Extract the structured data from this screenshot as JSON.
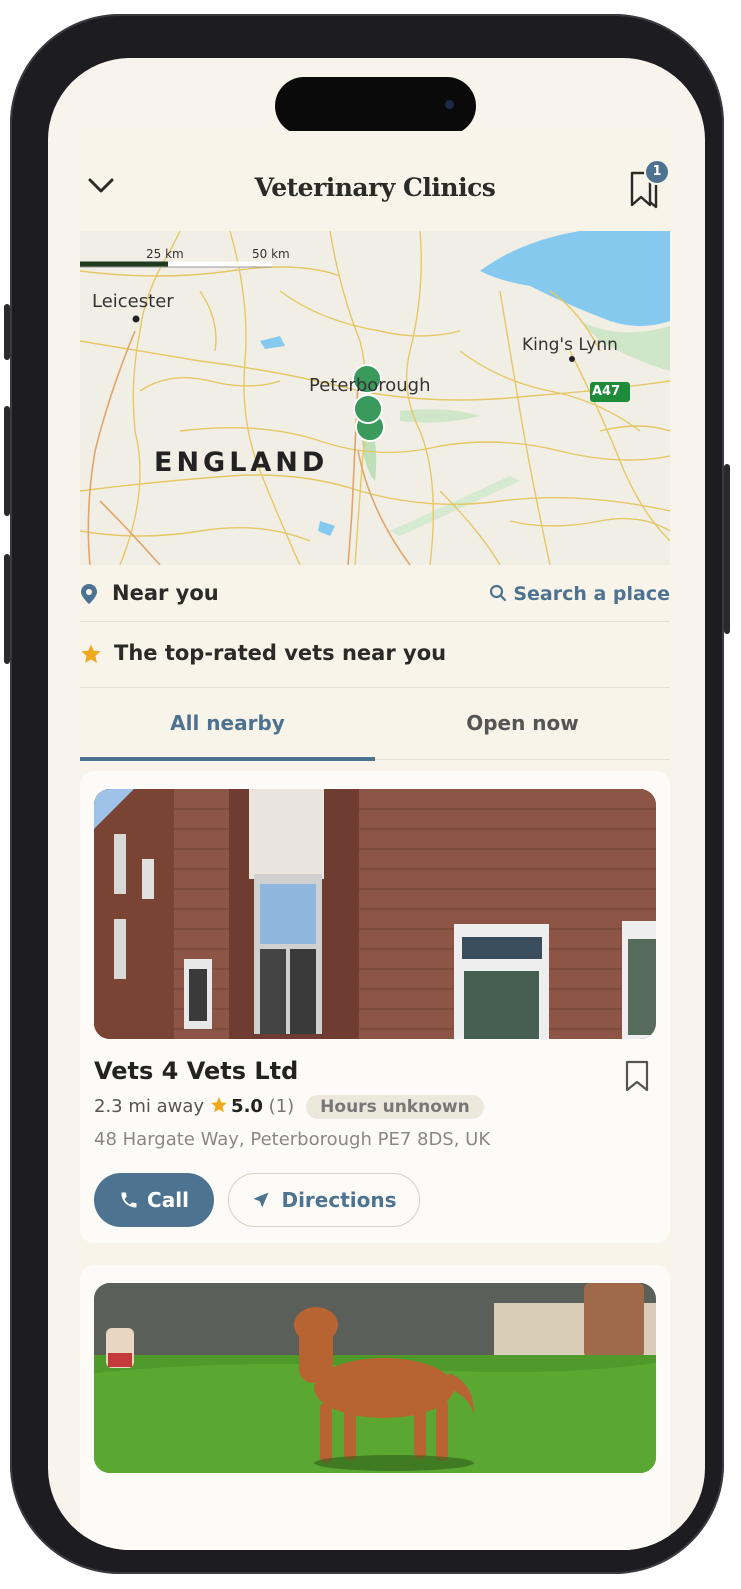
{
  "header": {
    "title": "Veterinary Clinics",
    "saved_count": "1"
  },
  "map": {
    "scale_labels": [
      "25 km",
      "50 km"
    ],
    "places": [
      "Leicester",
      "Peterborough",
      "King's Lynn",
      "ENGLAND"
    ],
    "road_label": "A47"
  },
  "location": {
    "near_label": "Near you",
    "search_label": "Search a place"
  },
  "top_rated": {
    "text": "The top-rated vets near you"
  },
  "tabs": [
    {
      "label": "All nearby",
      "active": true
    },
    {
      "label": "Open now",
      "active": false
    }
  ],
  "results": [
    {
      "name": "Vets 4 Vets Ltd",
      "distance": "2.3 mi away",
      "rating": "5.0",
      "reviews": "(1)",
      "hours": "Hours unknown",
      "address": "48 Hargate Way, Peterborough PE7 8DS, UK",
      "call_label": "Call",
      "directions_label": "Directions"
    }
  ],
  "colors": {
    "accent": "#4e7391",
    "star": "#f0a81c",
    "marker": "#3a9a5c",
    "water": "#86c9ee"
  }
}
